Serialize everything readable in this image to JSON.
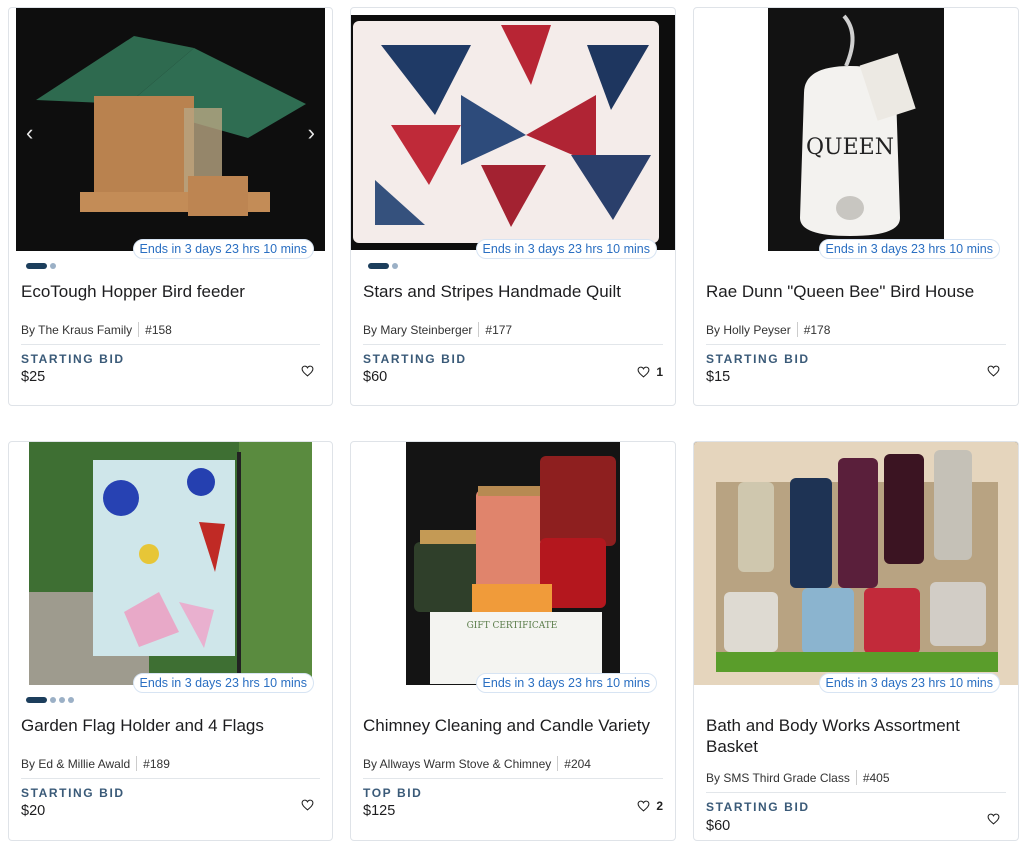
{
  "items": [
    {
      "title": "EcoTough Hopper Bird feeder",
      "by": "By The Kraus Family",
      "lot": "#158",
      "bid_label": "STARTING BID",
      "bid": "$25",
      "countdown": "Ends in 3 days 23 hrs 10 mins",
      "favorites": "",
      "images": 2
    },
    {
      "title": "Stars and Stripes Handmade Quilt",
      "by": "By Mary Steinberger",
      "lot": "#177",
      "bid_label": "STARTING BID",
      "bid": "$60",
      "countdown": "Ends in 3 days 23 hrs 10 mins",
      "favorites": "1",
      "images": 2
    },
    {
      "title": "Rae Dunn \"Queen Bee\" Bird House",
      "by": "By Holly Peyser",
      "lot": "#178",
      "bid_label": "STARTING BID",
      "bid": "$15",
      "countdown": "Ends in 3 days 23 hrs 10 mins",
      "favorites": "",
      "images": 1,
      "image_text": "QUEEN"
    },
    {
      "title": "Garden Flag Holder and 4 Flags",
      "by": "By Ed & Millie Awald",
      "lot": "#189",
      "bid_label": "STARTING BID",
      "bid": "$20",
      "countdown": "Ends in 3 days 23 hrs 10 mins",
      "favorites": "",
      "images": 4
    },
    {
      "title": "Chimney Cleaning and Candle Variety",
      "by": "By Allways Warm Stove & Chimney",
      "lot": "#204",
      "bid_label": "TOP BID",
      "bid": "$125",
      "countdown": "Ends in 3 days 23 hrs 10 mins",
      "favorites": "2",
      "images": 1,
      "image_text": "GIFT CERTIFICATE"
    },
    {
      "title": "Bath and Body Works Assortment Basket",
      "by": "By SMS Third Grade Class",
      "lot": "#405",
      "bid_label": "STARTING BID",
      "bid": "$60",
      "countdown": "Ends in 3 days 23 hrs 10 mins",
      "favorites": "",
      "images": 1
    }
  ],
  "icons": {
    "favorite": "heart-outline-icon",
    "prev": "chevron-left-icon",
    "next": "chevron-right-icon"
  },
  "colors": {
    "countdown": "#2a6fc2",
    "bid_label": "#3a5a78",
    "dot_active": "#1c3e5c"
  }
}
